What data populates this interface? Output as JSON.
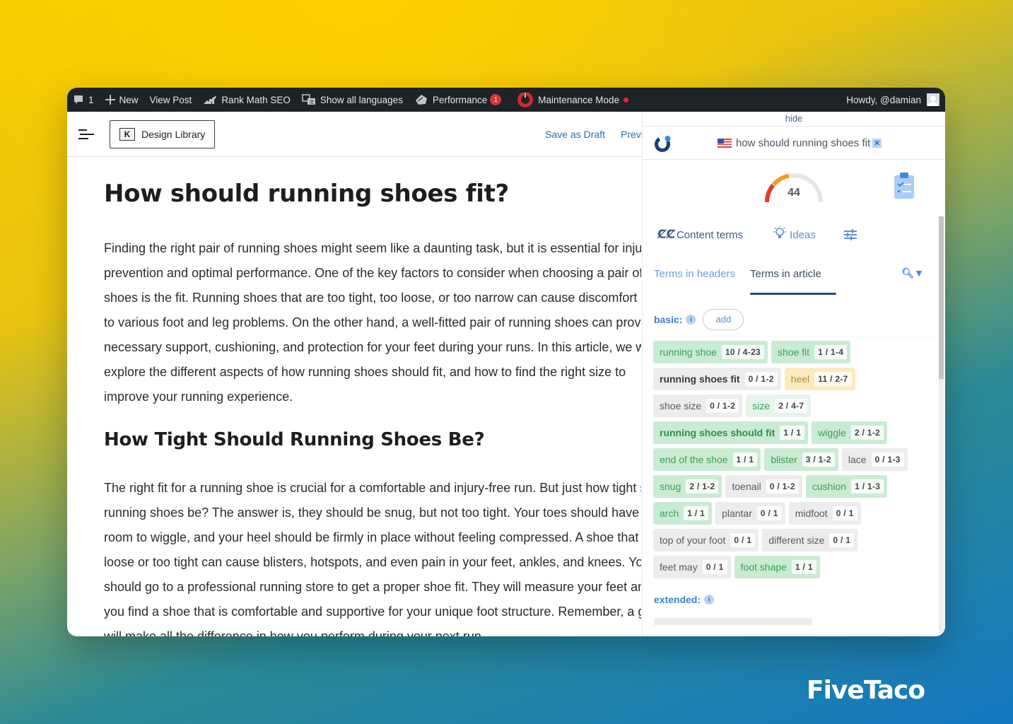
{
  "admin_bar": {
    "comments_count": "1",
    "new_label": "New",
    "view_post_label": "View Post",
    "rank_math_label": "Rank Math SEO",
    "languages_label": "Show all languages",
    "performance_label": "Performance",
    "performance_badge": "1",
    "maintenance_label": "Maintenance Mode",
    "greeting": "Howdy, @damian",
    "icons": [
      "comment-icon",
      "plus-icon",
      "rank-math-icon",
      "translate-icon",
      "performance-icon",
      "maintenance-icon",
      "avatar"
    ]
  },
  "editor_header": {
    "design_library_label": "Design Library",
    "save_draft_label": "Save as Draft",
    "preview_label": "Preview"
  },
  "article": {
    "title": "How should running shoes fit?",
    "paragraph1_lines": [
      "Finding the right pair of running shoes might seem like a daunting task, but it is essential for injury",
      "prevention and optimal performance. One of the key factors to consider when choosing a pair of running",
      "shoes is the fit. Running shoes that are too tight, too loose, or too narrow can cause discomfort and lead",
      "to various foot and leg problems. On the other hand, a well-fitted pair of running shoes can provide the",
      "necessary support, cushioning, and protection for your feet during your runs. In this article, we will",
      "explore the different aspects of how running shoes should fit, and how to find the right size to",
      "improve your running experience."
    ],
    "heading2": "How Tight Should Running Shoes Be?",
    "paragraph2_lines": [
      "The right fit for a running shoe is crucial for a comfortable and injury-free run. But just how tight should",
      "running shoes be? The answer is, they should be snug, but not too tight. Your toes should have enough",
      "room to wiggle, and your heel should be firmly in place without feeling compressed. A shoe that is too",
      "loose or too tight can cause blisters, hotspots, and even pain in your feet, ankles, and knees. You",
      "should go to a professional running store to get a proper shoe fit. They will measure your feet and help",
      "you find a shoe that is comfortable and supportive for your unique foot structure. Remember, a good fit",
      "will make all the difference in how you perform during your next run."
    ]
  },
  "seo_panel": {
    "hide_label": "hide",
    "keyword": "how should running shoes fit",
    "score": "44",
    "score_value": 44,
    "score_max": 100,
    "tools": {
      "content_terms": "Content terms",
      "ideas": "Ideas"
    },
    "tabs": {
      "headers": "Terms in headers",
      "article": "Terms in article",
      "active": "article"
    },
    "basic_label": "basic:",
    "add_label": "add",
    "extended_label": "extended:",
    "info_glyph": "i",
    "terms": [
      {
        "label": "running shoe",
        "count": "10 / 4-23",
        "status": "green"
      },
      {
        "label": "shoe fit",
        "count": "1 / 1-4",
        "status": "green"
      },
      {
        "label": "running shoes fit",
        "count": "0 / 1-2",
        "status": "gray"
      },
      {
        "label": "heel",
        "count": "11 / 2-7",
        "status": "orange"
      },
      {
        "label": "shoe size",
        "count": "0 / 1-2",
        "status": "gray"
      },
      {
        "label": "size",
        "count": "2 / 4-7",
        "status": "lightgreen"
      },
      {
        "label": "running shoes should fit",
        "count": "1 / 1",
        "status": "green"
      },
      {
        "label": "wiggle",
        "count": "2 / 1-2",
        "status": "green"
      },
      {
        "label": "end of the shoe",
        "count": "1 / 1",
        "status": "green"
      },
      {
        "label": "blister",
        "count": "3 / 1-2",
        "status": "green"
      },
      {
        "label": "lace",
        "count": "0 / 1-3",
        "status": "gray"
      },
      {
        "label": "snug",
        "count": "2 / 1-2",
        "status": "green"
      },
      {
        "label": "toenail",
        "count": "0 / 1-2",
        "status": "gray"
      },
      {
        "label": "cushion",
        "count": "1 / 1-3",
        "status": "green"
      },
      {
        "label": "arch",
        "count": "1 / 1",
        "status": "green"
      },
      {
        "label": "plantar",
        "count": "0 / 1",
        "status": "gray"
      },
      {
        "label": "midfoot",
        "count": "0 / 1",
        "status": "gray"
      },
      {
        "label": "top of your foot",
        "count": "0 / 1",
        "status": "gray"
      },
      {
        "label": "different size",
        "count": "0 / 1",
        "status": "gray"
      },
      {
        "label": "feet may",
        "count": "0 / 1",
        "status": "gray"
      },
      {
        "label": "foot shape",
        "count": "1 / 1",
        "status": "green"
      }
    ],
    "colors": {
      "green": "#c9ebd2",
      "gray": "#ececec",
      "orange": "#fbeac0",
      "gauge_red": "#e53a2f",
      "gauge_orange": "#f39a1f",
      "accent_blue": "#3f7fd0"
    }
  },
  "brand": "FiveTaco"
}
